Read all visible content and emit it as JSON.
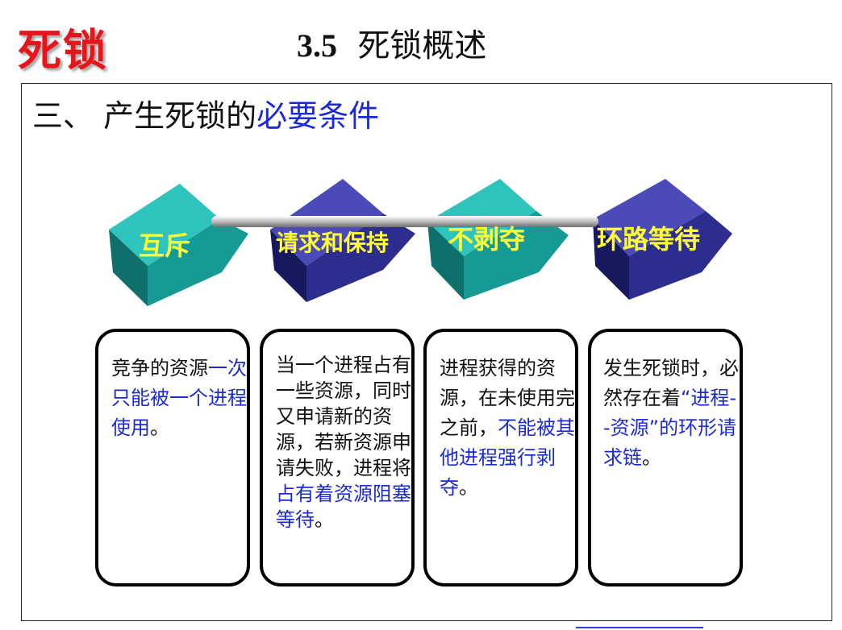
{
  "logo": {
    "text": "死锁"
  },
  "title": {
    "number": "3.5",
    "text": "死锁概述"
  },
  "section": {
    "prefix": "三、 产生死锁的",
    "highlight": "必要条件"
  },
  "conditions": [
    {
      "label": "互斥",
      "cube_color": "#1aa6a0",
      "desc_plain": "竞争的资源",
      "desc_highlight": "一次只能被一个进程使用",
      "desc_tail": "。"
    },
    {
      "label": "请求和保持",
      "cube_color": "#2c2d8c",
      "desc_plain": "当一个进程占有一些资源，同时又申请新的资源，若新资源申请失败，进程将",
      "desc_highlight": "占有着资源阻塞等待",
      "desc_tail": "。"
    },
    {
      "label": "不剥夺",
      "cube_color": "#1aa6a0",
      "desc_plain": "进程获得的资源，在未使用完之前，",
      "desc_highlight": "不能被其他进程强行剥夺",
      "desc_tail": "。"
    },
    {
      "label": "环路等待",
      "cube_color": "#2c2d8c",
      "desc_plain": "发生死锁时，必然存在着",
      "desc_highlight": "“进程--资源”的环形请求链",
      "desc_tail": "。"
    }
  ],
  "colors": {
    "accent_red": "#e8141b",
    "highlight_blue": "#1c29d6",
    "label_yellow": "#ffff33"
  }
}
